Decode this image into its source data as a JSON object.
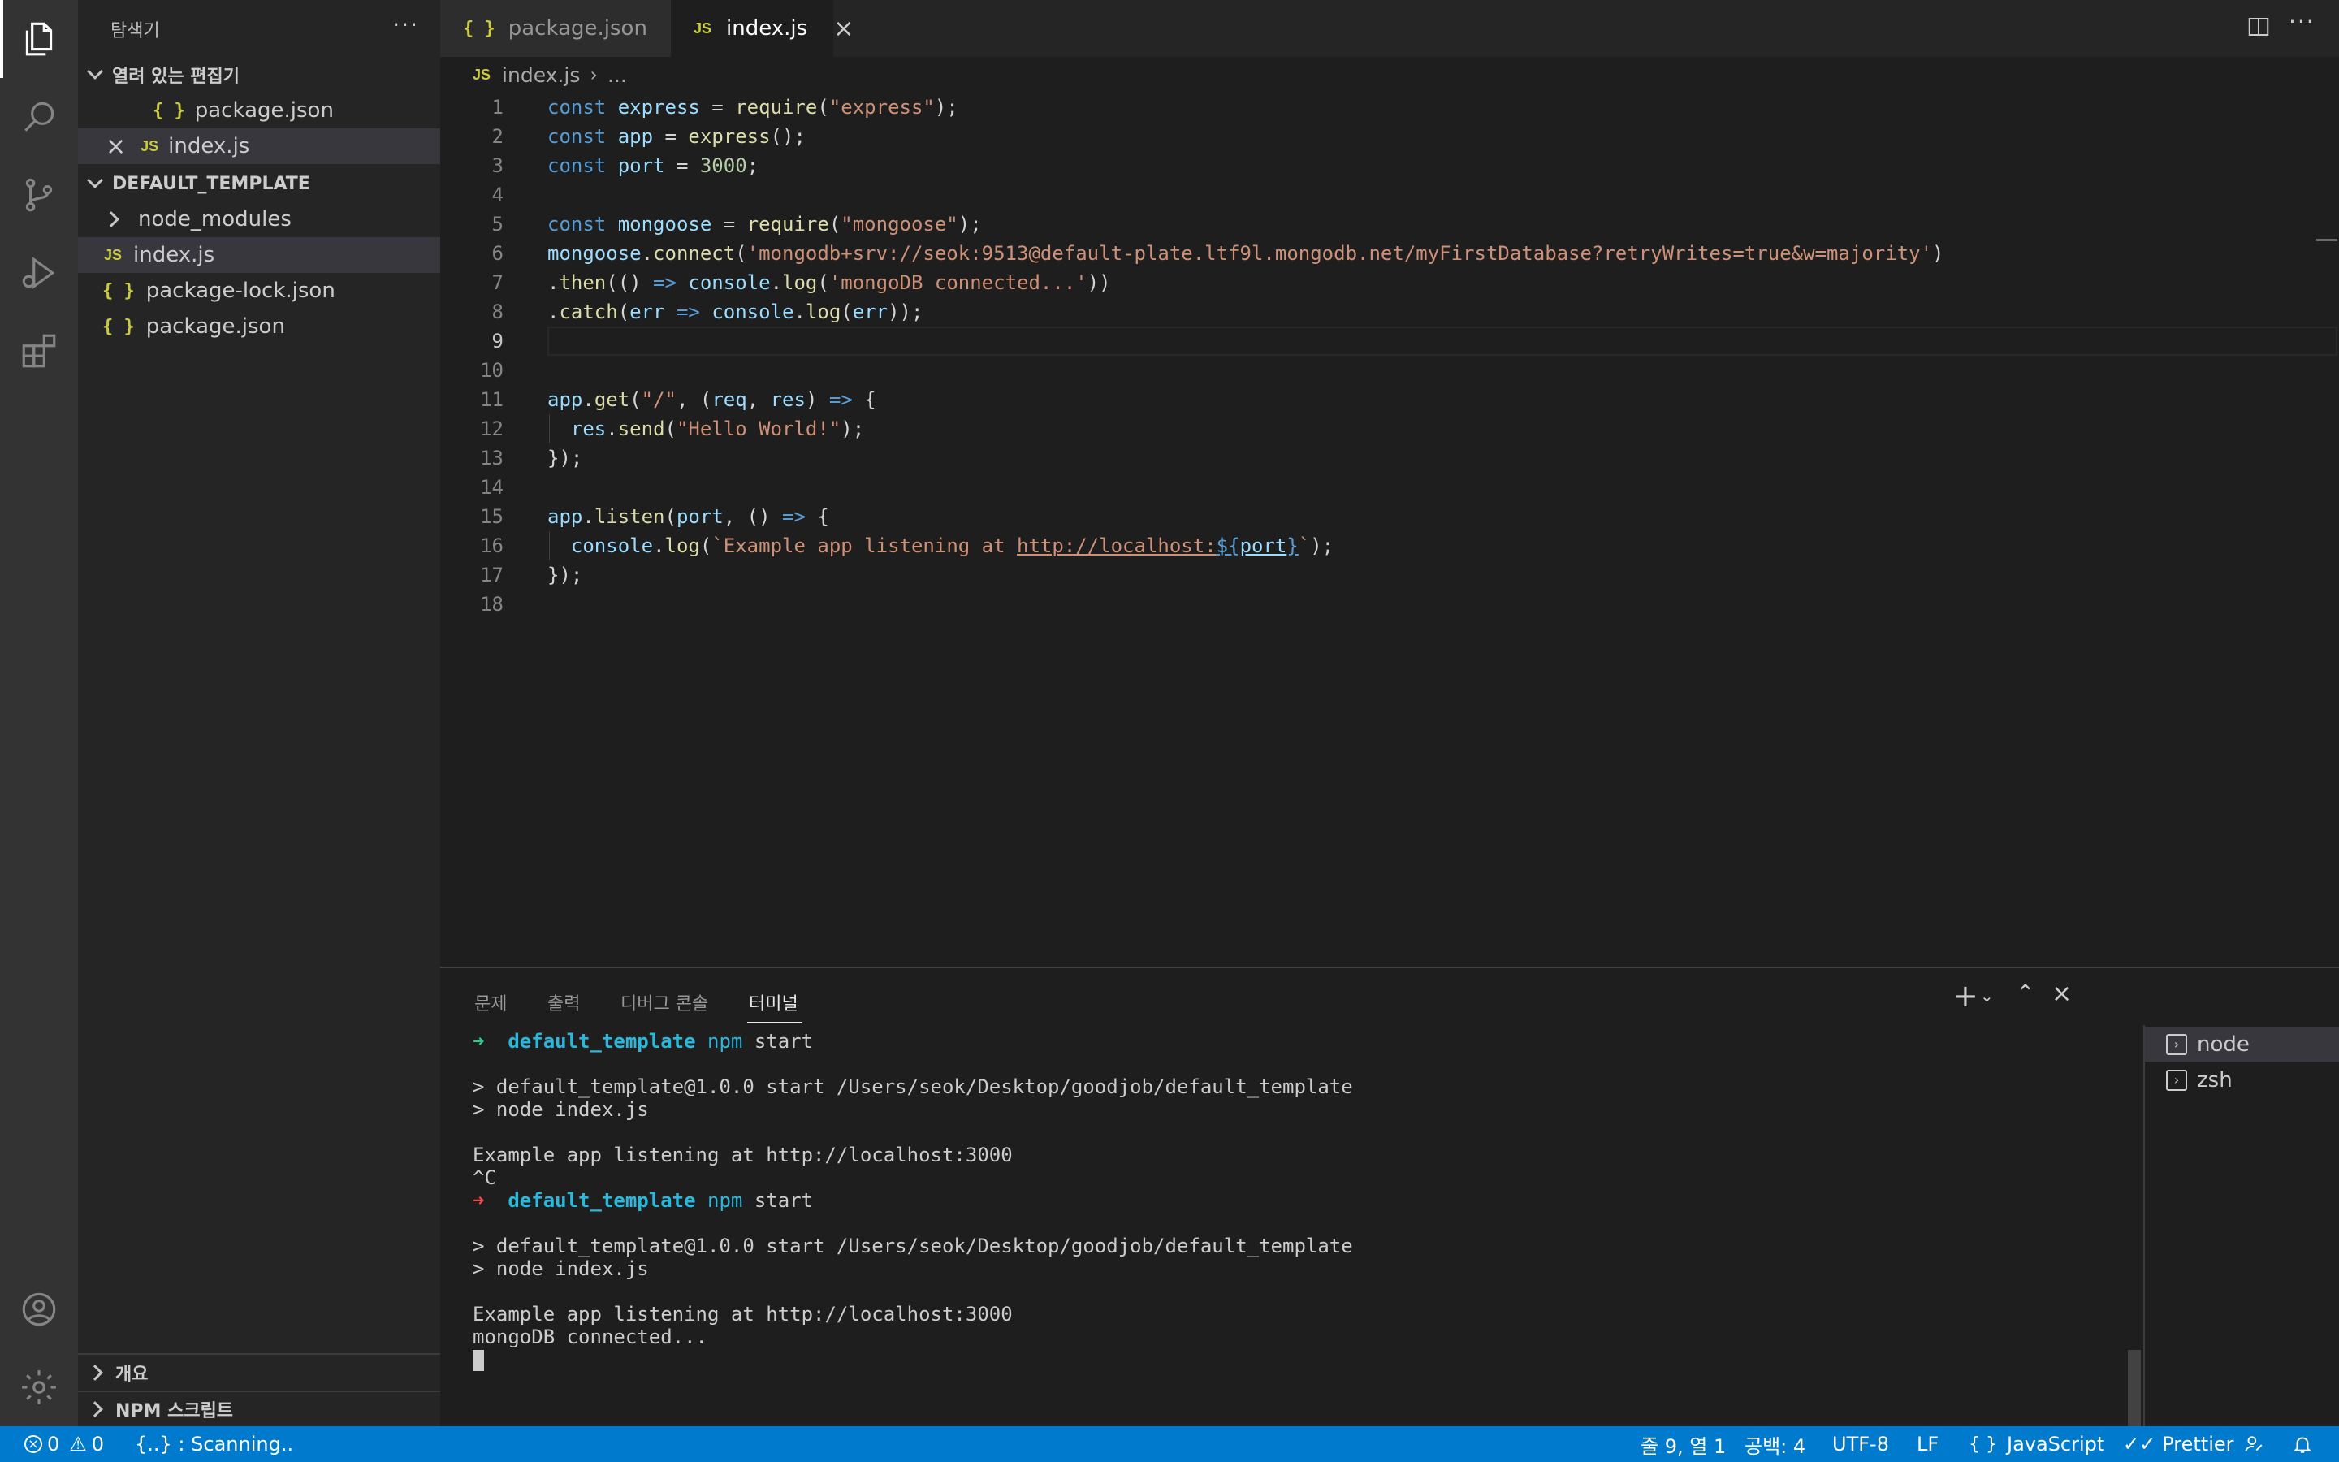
{
  "sidebar": {
    "title": "탐색기",
    "open_editors_label": "열려 있는 편집기",
    "open_editors": [
      {
        "name": "package.json",
        "type": "json",
        "close": ""
      },
      {
        "name": "index.js",
        "type": "js",
        "close": "×"
      }
    ],
    "project_label": "DEFAULT_TEMPLATE",
    "files": [
      {
        "name": "node_modules",
        "type": "folder"
      },
      {
        "name": "index.js",
        "type": "js"
      },
      {
        "name": "package-lock.json",
        "type": "json"
      },
      {
        "name": "package.json",
        "type": "json"
      }
    ],
    "outline_label": "개요",
    "npm_label": "NPM 스크립트"
  },
  "tabs": [
    {
      "label": "package.json",
      "icon": "{ }"
    },
    {
      "label": "index.js",
      "icon": "JS"
    }
  ],
  "breadcrumb": {
    "file": "index.js",
    "rest": "..."
  },
  "editor": {
    "line_numbers": [
      "1",
      "2",
      "3",
      "4",
      "5",
      "6",
      "7",
      "8",
      "9",
      "10",
      "11",
      "12",
      "13",
      "14",
      "15",
      "16",
      "17",
      "18"
    ],
    "current_line": 9
  },
  "panel": {
    "tabs": [
      "문제",
      "출력",
      "디버그 콘솔",
      "터미널"
    ],
    "active_tab": "터미널",
    "terminals": [
      "node",
      "zsh"
    ],
    "output": {
      "prompt_dir": "default_template",
      "cmd": "npm",
      "cmd_arg": "start",
      "start_line": "> default_template@1.0.0 start /Users/seok/Desktop/goodjob/default_template",
      "node_line": "> node index.js",
      "listening": "Example app listening at http://localhost:3000",
      "interrupt": "^C",
      "connected": "mongoDB connected..."
    }
  },
  "status": {
    "errors": "0",
    "warnings": "0",
    "scanning": "{..} : Scanning..",
    "position": "줄 9, 열 1",
    "spaces": "공백: 4",
    "encoding": "UTF-8",
    "eol": "LF",
    "language": "JavaScript",
    "formatter": "Prettier"
  },
  "colors": {
    "activity_bar": "#333333",
    "sidebar": "#252526",
    "editor": "#1e1e1e",
    "status_bar": "#007acc",
    "keyword": "#569cd6",
    "string": "#ce9178",
    "function": "#dcdcaa"
  }
}
